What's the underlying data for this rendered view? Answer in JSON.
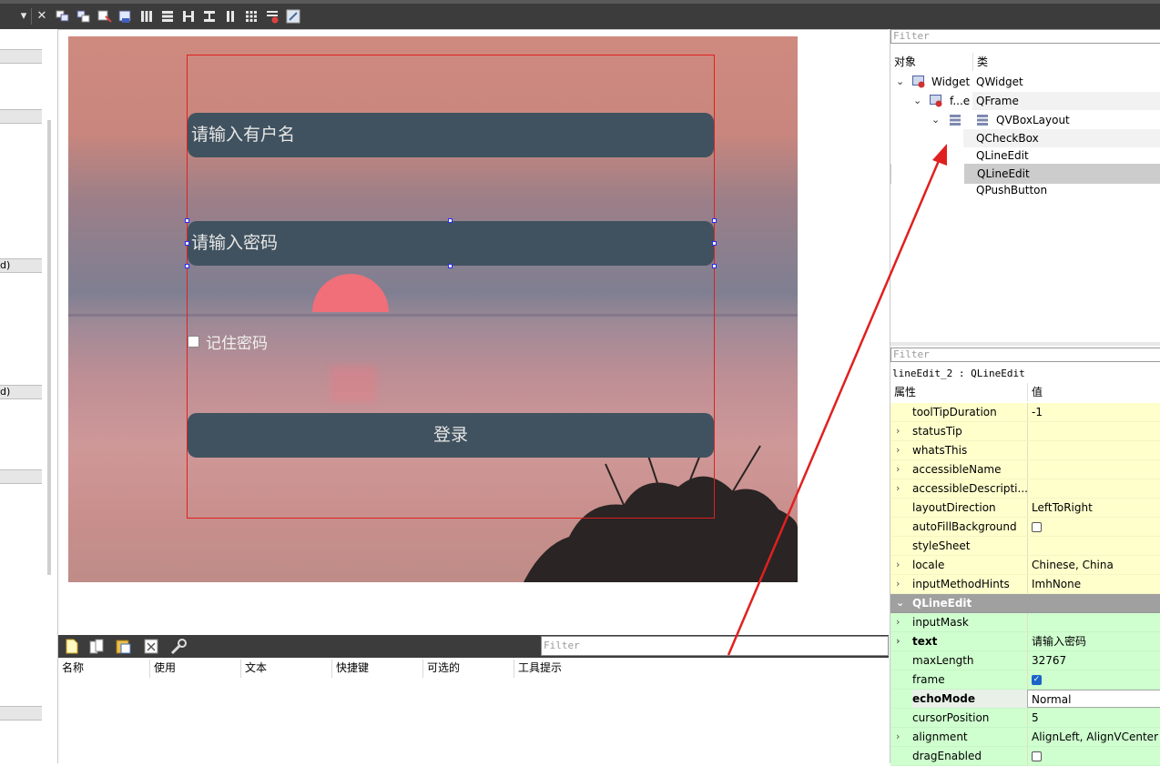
{
  "colors": {
    "toolbar_bg": "#3c3c3c",
    "line_edit_bg": "#40525f",
    "frame_outline": "#e02020",
    "qwidget_prop_bg": "#ffffcc",
    "qlineedit_prop_bg": "#cfffcf",
    "section_header_bg": "#a0a0a0",
    "annotation_arrow": "#e02020"
  },
  "toolbar": {
    "icons": [
      "dropdown-icon",
      "close-icon",
      "layout-h-icon",
      "layout-v-icon",
      "buddy-icon",
      "tab-order-icon",
      "hbox-icon",
      "vbox-icon",
      "splitter-h-icon",
      "splitter-v-icon",
      "grid-icon",
      "form-layout-icon",
      "break-layout-icon",
      "adjust-size-icon"
    ]
  },
  "left_panel": {
    "sections": [
      "",
      "",
      "d)",
      "d)",
      "",
      ""
    ]
  },
  "form": {
    "username_placeholder": "请输入有户名",
    "password_text": "请输入密码",
    "remember_label": "记住密码",
    "login_label": "登录"
  },
  "action_editor": {
    "filter_placeholder": "Filter",
    "columns": [
      "名称",
      "使用",
      "文本",
      "快捷键",
      "可选的",
      "工具提示"
    ]
  },
  "object_inspector": {
    "filter_placeholder": "Filter",
    "header": {
      "object": "对象",
      "class": "类"
    },
    "rows": [
      {
        "name": "Widget",
        "class": "QWidget"
      },
      {
        "name": "f...e",
        "class": "QFrame"
      },
      {
        "name": "",
        "class": "QVBoxLayout"
      },
      {
        "name": "",
        "class": "QCheckBox"
      },
      {
        "name": "",
        "class": "QLineEdit"
      },
      {
        "name": "",
        "class": "QLineEdit"
      },
      {
        "name": "",
        "class": "QPushButton"
      }
    ]
  },
  "property_editor": {
    "filter_placeholder": "Filter",
    "object_label": "lineEdit_2 : QLineEdit",
    "header": {
      "property": "属性",
      "value": "值"
    },
    "widget_props": [
      {
        "name": "toolTipDuration",
        "value": "-1"
      },
      {
        "name": "statusTip",
        "value": ""
      },
      {
        "name": "whatsThis",
        "value": ""
      },
      {
        "name": "accessibleName",
        "value": ""
      },
      {
        "name": "accessibleDescripti...",
        "value": ""
      },
      {
        "name": "layoutDirection",
        "value": "LeftToRight"
      },
      {
        "name": "autoFillBackground",
        "value": ""
      },
      {
        "name": "styleSheet",
        "value": ""
      },
      {
        "name": "locale",
        "value": "Chinese, China"
      },
      {
        "name": "inputMethodHints",
        "value": "ImhNone"
      }
    ],
    "section": "QLineEdit",
    "lineedit_props": [
      {
        "name": "inputMask",
        "value": ""
      },
      {
        "name": "text",
        "value": "请输入密码"
      },
      {
        "name": "maxLength",
        "value": "32767"
      },
      {
        "name": "frame",
        "value": ""
      },
      {
        "name": "echoMode",
        "value": "Normal"
      },
      {
        "name": "cursorPosition",
        "value": "5"
      },
      {
        "name": "alignment",
        "value": "AlignLeft, AlignVCenter"
      },
      {
        "name": "dragEnabled",
        "value": ""
      }
    ]
  }
}
